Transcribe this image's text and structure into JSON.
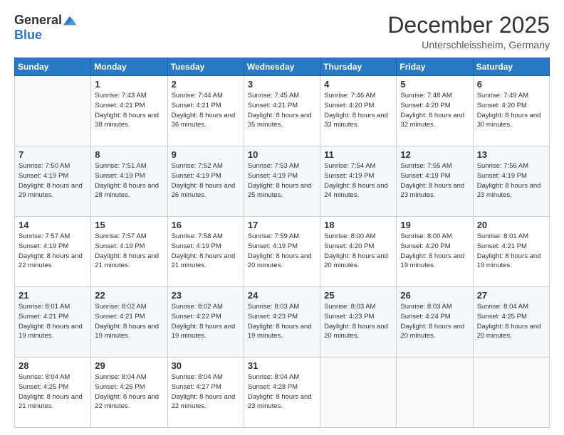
{
  "logo": {
    "general": "General",
    "blue": "Blue"
  },
  "title": "December 2025",
  "location": "Unterschleissheim, Germany",
  "days_header": [
    "Sunday",
    "Monday",
    "Tuesday",
    "Wednesday",
    "Thursday",
    "Friday",
    "Saturday"
  ],
  "weeks": [
    [
      {
        "day": "",
        "sunrise": "",
        "sunset": "",
        "daylight": ""
      },
      {
        "day": "1",
        "sunrise": "Sunrise: 7:43 AM",
        "sunset": "Sunset: 4:21 PM",
        "daylight": "Daylight: 8 hours and 38 minutes."
      },
      {
        "day": "2",
        "sunrise": "Sunrise: 7:44 AM",
        "sunset": "Sunset: 4:21 PM",
        "daylight": "Daylight: 8 hours and 36 minutes."
      },
      {
        "day": "3",
        "sunrise": "Sunrise: 7:45 AM",
        "sunset": "Sunset: 4:21 PM",
        "daylight": "Daylight: 8 hours and 35 minutes."
      },
      {
        "day": "4",
        "sunrise": "Sunrise: 7:46 AM",
        "sunset": "Sunset: 4:20 PM",
        "daylight": "Daylight: 8 hours and 33 minutes."
      },
      {
        "day": "5",
        "sunrise": "Sunrise: 7:48 AM",
        "sunset": "Sunset: 4:20 PM",
        "daylight": "Daylight: 8 hours and 32 minutes."
      },
      {
        "day": "6",
        "sunrise": "Sunrise: 7:49 AM",
        "sunset": "Sunset: 4:20 PM",
        "daylight": "Daylight: 8 hours and 30 minutes."
      }
    ],
    [
      {
        "day": "7",
        "sunrise": "Sunrise: 7:50 AM",
        "sunset": "Sunset: 4:19 PM",
        "daylight": "Daylight: 8 hours and 29 minutes."
      },
      {
        "day": "8",
        "sunrise": "Sunrise: 7:51 AM",
        "sunset": "Sunset: 4:19 PM",
        "daylight": "Daylight: 8 hours and 28 minutes."
      },
      {
        "day": "9",
        "sunrise": "Sunrise: 7:52 AM",
        "sunset": "Sunset: 4:19 PM",
        "daylight": "Daylight: 8 hours and 26 minutes."
      },
      {
        "day": "10",
        "sunrise": "Sunrise: 7:53 AM",
        "sunset": "Sunset: 4:19 PM",
        "daylight": "Daylight: 8 hours and 25 minutes."
      },
      {
        "day": "11",
        "sunrise": "Sunrise: 7:54 AM",
        "sunset": "Sunset: 4:19 PM",
        "daylight": "Daylight: 8 hours and 24 minutes."
      },
      {
        "day": "12",
        "sunrise": "Sunrise: 7:55 AM",
        "sunset": "Sunset: 4:19 PM",
        "daylight": "Daylight: 8 hours and 23 minutes."
      },
      {
        "day": "13",
        "sunrise": "Sunrise: 7:56 AM",
        "sunset": "Sunset: 4:19 PM",
        "daylight": "Daylight: 8 hours and 23 minutes."
      }
    ],
    [
      {
        "day": "14",
        "sunrise": "Sunrise: 7:57 AM",
        "sunset": "Sunset: 4:19 PM",
        "daylight": "Daylight: 8 hours and 22 minutes."
      },
      {
        "day": "15",
        "sunrise": "Sunrise: 7:57 AM",
        "sunset": "Sunset: 4:19 PM",
        "daylight": "Daylight: 8 hours and 21 minutes."
      },
      {
        "day": "16",
        "sunrise": "Sunrise: 7:58 AM",
        "sunset": "Sunset: 4:19 PM",
        "daylight": "Daylight: 8 hours and 21 minutes."
      },
      {
        "day": "17",
        "sunrise": "Sunrise: 7:59 AM",
        "sunset": "Sunset: 4:19 PM",
        "daylight": "Daylight: 8 hours and 20 minutes."
      },
      {
        "day": "18",
        "sunrise": "Sunrise: 8:00 AM",
        "sunset": "Sunset: 4:20 PM",
        "daylight": "Daylight: 8 hours and 20 minutes."
      },
      {
        "day": "19",
        "sunrise": "Sunrise: 8:00 AM",
        "sunset": "Sunset: 4:20 PM",
        "daylight": "Daylight: 8 hours and 19 minutes."
      },
      {
        "day": "20",
        "sunrise": "Sunrise: 8:01 AM",
        "sunset": "Sunset: 4:21 PM",
        "daylight": "Daylight: 8 hours and 19 minutes."
      }
    ],
    [
      {
        "day": "21",
        "sunrise": "Sunrise: 8:01 AM",
        "sunset": "Sunset: 4:21 PM",
        "daylight": "Daylight: 8 hours and 19 minutes."
      },
      {
        "day": "22",
        "sunrise": "Sunrise: 8:02 AM",
        "sunset": "Sunset: 4:21 PM",
        "daylight": "Daylight: 8 hours and 19 minutes."
      },
      {
        "day": "23",
        "sunrise": "Sunrise: 8:02 AM",
        "sunset": "Sunset: 4:22 PM",
        "daylight": "Daylight: 8 hours and 19 minutes."
      },
      {
        "day": "24",
        "sunrise": "Sunrise: 8:03 AM",
        "sunset": "Sunset: 4:23 PM",
        "daylight": "Daylight: 8 hours and 19 minutes."
      },
      {
        "day": "25",
        "sunrise": "Sunrise: 8:03 AM",
        "sunset": "Sunset: 4:23 PM",
        "daylight": "Daylight: 8 hours and 20 minutes."
      },
      {
        "day": "26",
        "sunrise": "Sunrise: 8:03 AM",
        "sunset": "Sunset: 4:24 PM",
        "daylight": "Daylight: 8 hours and 20 minutes."
      },
      {
        "day": "27",
        "sunrise": "Sunrise: 8:04 AM",
        "sunset": "Sunset: 4:25 PM",
        "daylight": "Daylight: 8 hours and 20 minutes."
      }
    ],
    [
      {
        "day": "28",
        "sunrise": "Sunrise: 8:04 AM",
        "sunset": "Sunset: 4:25 PM",
        "daylight": "Daylight: 8 hours and 21 minutes."
      },
      {
        "day": "29",
        "sunrise": "Sunrise: 8:04 AM",
        "sunset": "Sunset: 4:26 PM",
        "daylight": "Daylight: 8 hours and 22 minutes."
      },
      {
        "day": "30",
        "sunrise": "Sunrise: 8:04 AM",
        "sunset": "Sunset: 4:27 PM",
        "daylight": "Daylight: 8 hours and 22 minutes."
      },
      {
        "day": "31",
        "sunrise": "Sunrise: 8:04 AM",
        "sunset": "Sunset: 4:28 PM",
        "daylight": "Daylight: 8 hours and 23 minutes."
      },
      {
        "day": "",
        "sunrise": "",
        "sunset": "",
        "daylight": ""
      },
      {
        "day": "",
        "sunrise": "",
        "sunset": "",
        "daylight": ""
      },
      {
        "day": "",
        "sunrise": "",
        "sunset": "",
        "daylight": ""
      }
    ]
  ]
}
